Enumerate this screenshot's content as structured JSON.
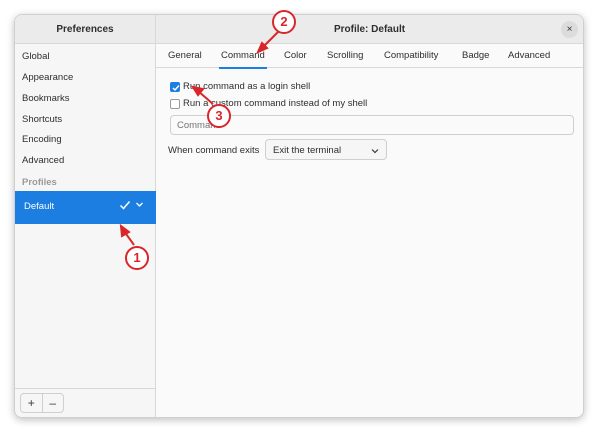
{
  "sidebar": {
    "title": "Preferences",
    "items": [
      {
        "label": "Global"
      },
      {
        "label": "Appearance"
      },
      {
        "label": "Bookmarks"
      },
      {
        "label": "Shortcuts"
      },
      {
        "label": "Encoding"
      },
      {
        "label": "Advanced"
      }
    ],
    "profiles_label": "Profiles",
    "selected_profile": "Default",
    "add_label": "+",
    "remove_label": "–"
  },
  "header": {
    "title": "Profile: Default",
    "close_label": "×"
  },
  "tabs": [
    {
      "label": "General"
    },
    {
      "label": "Command",
      "active": true
    },
    {
      "label": "Color"
    },
    {
      "label": "Scrolling"
    },
    {
      "label": "Compatibility"
    },
    {
      "label": "Badge"
    },
    {
      "label": "Advanced"
    }
  ],
  "command": {
    "login_shell_label": "Run command as a login shell",
    "login_shell_checked": true,
    "custom_command_label": "Run a custom command instead of my shell",
    "custom_command_checked": false,
    "command_placeholder": "Command",
    "exit_label": "When command exits",
    "exit_value": "Exit the terminal"
  },
  "annotations": [
    {
      "number": "1"
    },
    {
      "number": "2"
    },
    {
      "number": "3"
    }
  ],
  "colors": {
    "accent": "#1c7ee0",
    "annotation_red": "#d8262b"
  }
}
